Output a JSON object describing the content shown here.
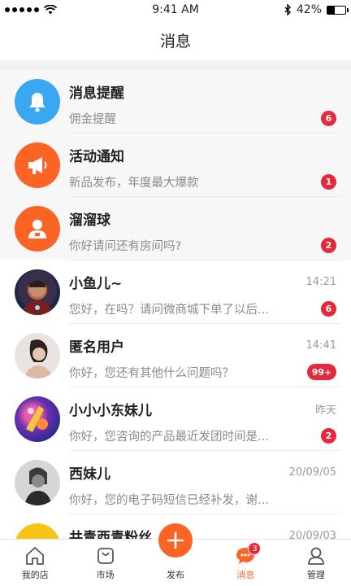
{
  "status_bar": {
    "time": "9:41 AM",
    "battery": "42%"
  },
  "header": {
    "title": "消息"
  },
  "messages": [
    {
      "name": "消息提醒",
      "preview": "佣金提醒",
      "time": "",
      "badge": "6",
      "icon": "bell-icon",
      "pinned": true
    },
    {
      "name": "活动通知",
      "preview": "新品发布，年度最大爆款",
      "time": "",
      "badge": "1",
      "icon": "megaphone-icon",
      "pinned": true
    },
    {
      "name": "溜溜球",
      "preview": "你好请问还有房间吗?",
      "time": "",
      "badge": "2",
      "icon": "user-icon",
      "pinned": true
    },
    {
      "name": "小鱼儿~",
      "preview": "您好，在吗？请问微商城下单了以后...",
      "time": "14:21",
      "badge": "6",
      "icon": "photo-avatar"
    },
    {
      "name": "匿名用户",
      "preview": "你好，您还有其他什么问题吗？",
      "time": "14:41",
      "badge": "99+",
      "icon": "photo-avatar"
    },
    {
      "name": "小小小东妹儿",
      "preview": "你好，您咨询的产品最近发团时间是...",
      "time": "昨天",
      "badge": "2",
      "icon": "photo-avatar"
    },
    {
      "name": "西妹儿",
      "preview": "你好，您的电子码短信已经补发，谢...",
      "time": "20/09/05",
      "badge": "",
      "icon": "photo-avatar"
    },
    {
      "name": "共青西青粉丝",
      "preview": "",
      "time": "20/09/03",
      "badge": "",
      "icon": "photo-avatar"
    }
  ],
  "tabbar": {
    "tabs": [
      {
        "label": "我的店",
        "icon": "house-icon"
      },
      {
        "label": "市场",
        "icon": "shopping-bag-icon"
      },
      {
        "label": "发布",
        "icon": "plus-icon"
      },
      {
        "label": "消息",
        "icon": "chat-icon",
        "badge": "3",
        "active": true
      },
      {
        "label": "管理",
        "icon": "person-icon"
      }
    ]
  },
  "colors": {
    "accent": "#fb6424",
    "badge": "#e5283a",
    "blue": "#3aa7f2"
  }
}
